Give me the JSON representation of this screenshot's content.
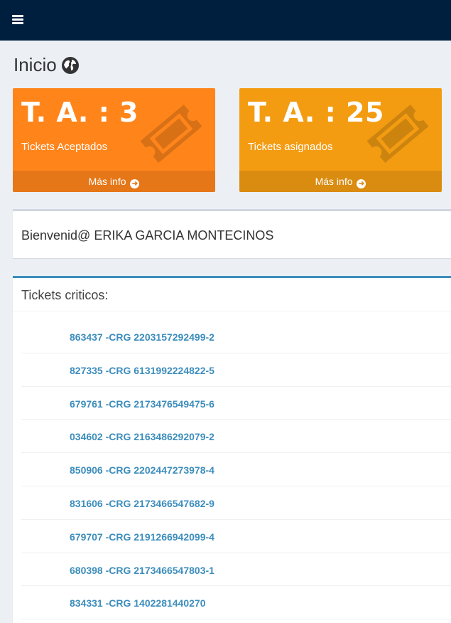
{
  "header": {
    "menu_icon": "hamburger-icon"
  },
  "page": {
    "title": "Inicio",
    "title_icon": "globe-icon"
  },
  "boxes": [
    {
      "value": "T. A. : 3",
      "label": "Tickets Aceptados",
      "footer": "Más info",
      "color": "#ff851b",
      "icon": "ticket-icon"
    },
    {
      "value": "T. A. : 25",
      "label": "Tickets asignados",
      "footer": "Más info",
      "color": "#f39c12",
      "icon": "ticket-icon"
    }
  ],
  "welcome": {
    "text": "Bienvenid@ ERIKA GARCIA MONTECINOS"
  },
  "critical": {
    "title": "Tickets criticos:",
    "tickets": [
      "863437 -CRG 2203157292499-2",
      "827335 -CRG 6131992224822-5",
      "679761 -CRG 2173476549475-6",
      "034602 -CRG 2163486292079-2",
      "850906 -CRG 2202447273978-4",
      "831606 -CRG 2173466547682-9",
      "679707 -CRG 2191266942099-4",
      "680398 -CRG 2173466547803-1",
      "834331 -CRG 1402281440270"
    ]
  },
  "colors": {
    "topbar": "#001f3f",
    "link": "#3c8dbc",
    "panel_border": "#3c8dbc"
  }
}
